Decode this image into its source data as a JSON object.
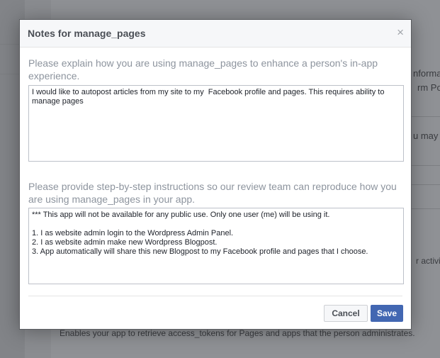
{
  "background": {
    "fragments": [
      "nforma",
      "rm Po",
      "u may",
      "r activit"
    ],
    "footer_text": "Enables your app to retrieve access_tokens for Pages and apps that the person administrates."
  },
  "dialog": {
    "title": "Notes for manage_pages",
    "close_glyph": "×",
    "question1": "Please explain how you are using manage_pages to enhance a person's in-app experience.",
    "answer1": "I would like to autopost articles from my site to my  Facebook profile and pages. This requires ability to manage pages",
    "question2": "Please provide step-by-step instructions so our review team can reproduce how you are using manage_pages in your app.",
    "answer2": "*** This app will not be available for any public use. Only one user (me) will be using it.\n\n1. I as website admin login to the Wordpress Admin Panel.\n2. I as website admin make new Wordpress Blogpost.\n3. App automatically will share this new Blogpost to my Facebook profile and pages that I choose.",
    "cancel_label": "Cancel",
    "save_label": "Save"
  },
  "colors": {
    "accent": "#4267b2",
    "question_text": "#8d949e"
  }
}
